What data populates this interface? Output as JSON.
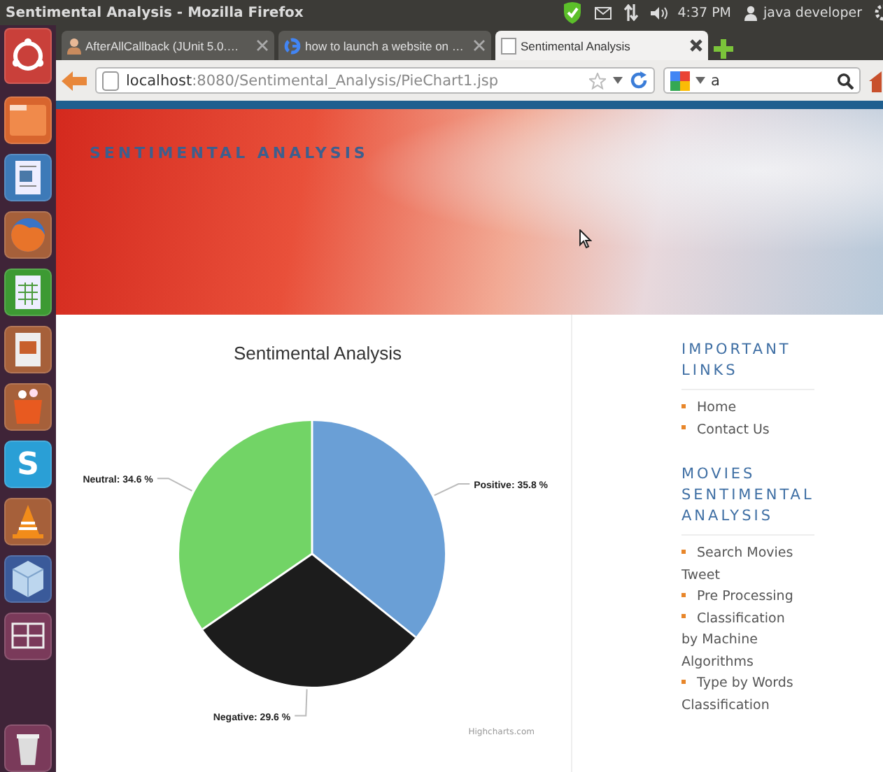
{
  "window": {
    "title": "Sentimental Analysis - Mozilla Firefox"
  },
  "panel": {
    "time": "4:37 PM",
    "user": "java developer"
  },
  "launcher": {
    "items": [
      {
        "kind": "ubuntu"
      },
      {
        "kind": "folder"
      },
      {
        "kind": "writer"
      },
      {
        "kind": "firefox"
      },
      {
        "kind": "calc"
      },
      {
        "kind": "impress"
      },
      {
        "kind": "store"
      },
      {
        "kind": "skype",
        "glyph": "S"
      },
      {
        "kind": "vlc"
      },
      {
        "kind": "box"
      },
      {
        "kind": "workspace"
      },
      {
        "kind": "trash"
      }
    ]
  },
  "tabs": [
    {
      "label": "AfterAllCallback (JUnit 5.0.…",
      "selected": false
    },
    {
      "label": "how to launch a website on …",
      "selected": false
    },
    {
      "label": "Sentimental Analysis",
      "selected": true
    }
  ],
  "navbar": {
    "url_host": "localhost",
    "url_path": ":8080/Sentimental_Analysis/PieChart1.jsp",
    "search_value": "a"
  },
  "page": {
    "header_title": "SENTIMENTAL ANALYSIS",
    "chart": {
      "credit": "Highcharts.com",
      "chart_data": {
        "type": "pie",
        "title": "Sentimental Analysis",
        "series": [
          {
            "colors": [
              "#6a9fd6",
              "#1c1c1c",
              "#72d466"
            ],
            "values": [
              35.8,
              29.6,
              34.6
            ]
          }
        ],
        "value_labels": [
          "Positive: 35.8 %",
          "Negative: 29.6 %",
          "Neutral: 34.6 %"
        ]
      }
    },
    "sidebar": [
      {
        "heading": "IMPORTANT LINKS",
        "links": [
          "Home",
          "Contact Us"
        ]
      },
      {
        "heading": "MOVIES SENTIMENTAL ANALYSIS",
        "links": [
          "Search Movies Tweet",
          "Pre Processing",
          "Classification by Machine Algorithms",
          "Type by Words Classification"
        ]
      }
    ]
  }
}
